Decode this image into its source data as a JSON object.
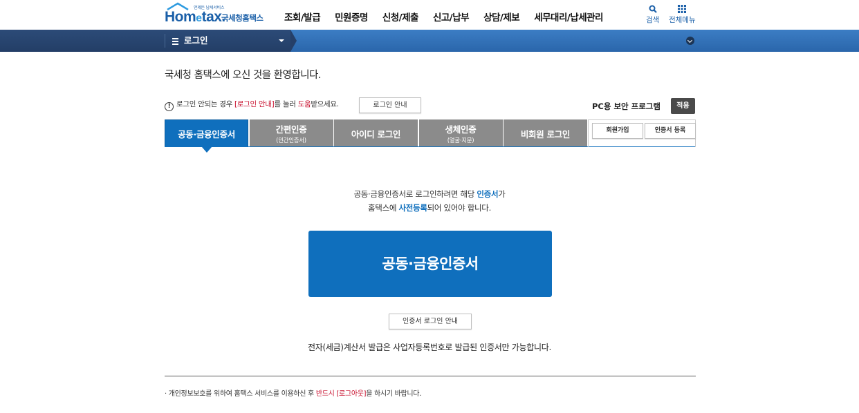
{
  "header": {
    "logo_tag": "언제든 납세서비스",
    "logo_text": "Hom",
    "logo_e": "e",
    "logo_text2": "tax.",
    "logo_name": "국세청홈택스",
    "nav": [
      "조회/발급",
      "민원증명",
      "신청/제출",
      "신고/납부",
      "상담/제보",
      "세무대리/납세관리"
    ],
    "search_label": "검색",
    "allmenu_label": "전체메뉴"
  },
  "bar": {
    "crumb": "로그인"
  },
  "welcome": "국세청 홈택스에 오신 것을 환영합니다.",
  "notice": {
    "icon": "!",
    "before": "로그인 안되는 경우 ",
    "highlight": "[로그인 안내]",
    "middle": "를 눌러 ",
    "highlight2": "도움",
    "after": "받으세요.",
    "button": "로그인 안내"
  },
  "security": {
    "label": "PC용 보안 프로그램",
    "button": "적용"
  },
  "tabs": [
    {
      "label": "공동·금융인증서",
      "sub": ""
    },
    {
      "label": "간편인증",
      "sub": "(민간인증서)"
    },
    {
      "label": "아이디 로그인",
      "sub": ""
    },
    {
      "label": "생체인증",
      "sub": "(얼굴·지문)"
    },
    {
      "label": "비회원 로그인",
      "sub": ""
    }
  ],
  "side_buttons": {
    "join": "회원가입",
    "cert_register": "인증서 등록"
  },
  "main": {
    "desc1_a": "공동·금융인증서로 로그인하려면 해당 ",
    "desc1_b": "인증서",
    "desc1_c": "가",
    "desc2_a": "홈택스에 ",
    "desc2_b": "사전등록",
    "desc2_c": "되어 있어야 합니다.",
    "big_button": "공동·금융인증서",
    "cert_guide": "인증서 로그인 안내",
    "note": "전자(세금)계산서 발급은 사업자등록번호로 발급된 인증서만 가능합니다."
  },
  "footer": {
    "a": "· 개인정보보호를 위하여 홈택스 서비스를 이용하신 후 ",
    "b": "반드시 [로그아웃]",
    "c": "을 하시기 바랍니다."
  },
  "colors": {
    "primary": "#0f6fbd",
    "tab_inactive": "#8b8b8b",
    "bar_dark": "#2c4b78",
    "bar_light": "#3c7dc4",
    "emphasis": "#c8102e"
  }
}
